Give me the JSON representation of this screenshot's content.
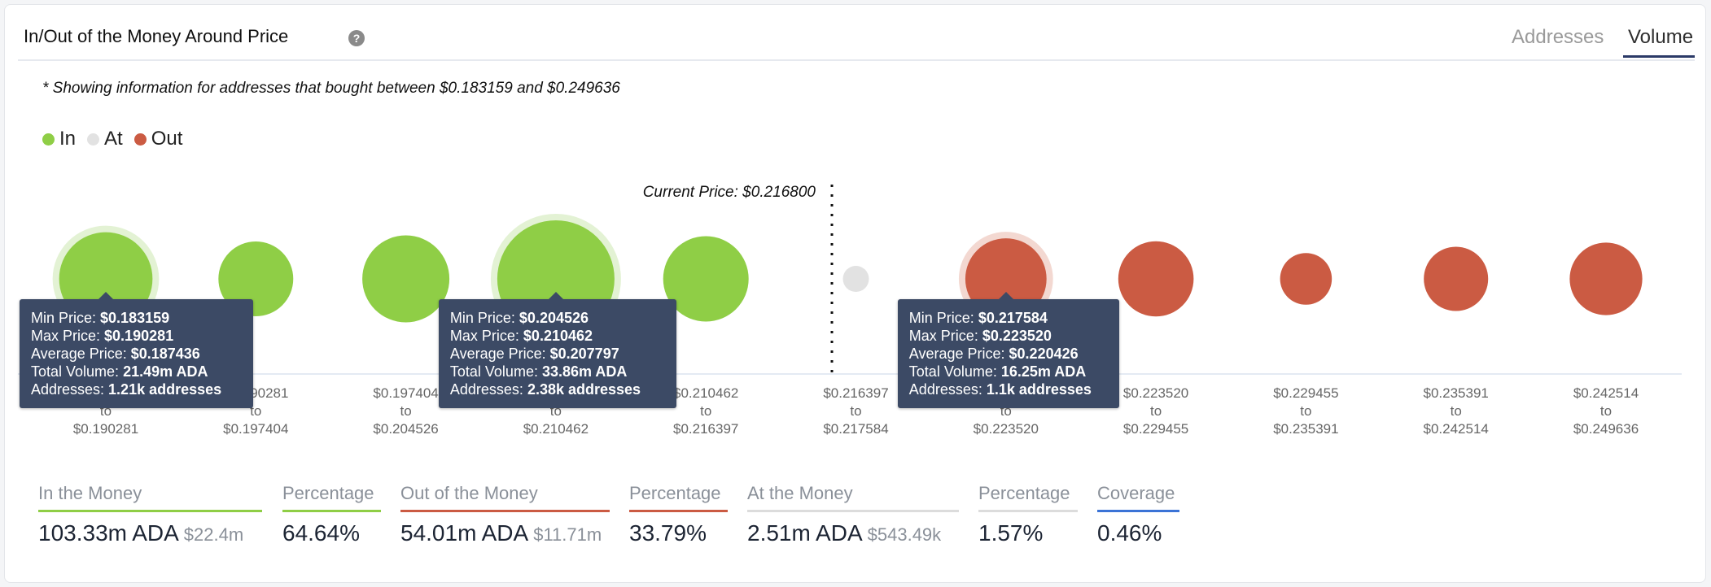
{
  "header": {
    "title": "In/Out of the Money Around Price",
    "help_icon": "question-circle-icon",
    "tabs": [
      {
        "label": "Addresses",
        "active": false
      },
      {
        "label": "Volume",
        "active": true
      }
    ]
  },
  "note": "* Showing information for addresses that bought between $0.183159 and $0.249636",
  "legend": [
    {
      "label": "In",
      "color": "#8fce46"
    },
    {
      "label": "At",
      "color": "#e2e2e2"
    },
    {
      "label": "Out",
      "color": "#cb5b43"
    }
  ],
  "colors": {
    "in": "#8fce46",
    "in_halo": "#e3f2d4",
    "at": "#e2e2e2",
    "out": "#cb5b43",
    "out_halo": "#f3d8d1",
    "tooltip_bg": "#3c4a65",
    "tab_active": "#2b3a67",
    "coverage": "#3b73d6"
  },
  "chart_data": {
    "type": "bubble",
    "title": "In/Out of the Money Around Price",
    "metric": "Total Volume (ADA)",
    "current_price_label": "Current Price: $0.216800",
    "current_price": 0.2168,
    "current_price_after_index": 4,
    "categories": [
      {
        "from": "$0.183159",
        "to": "$0.190281",
        "status": "in",
        "volume_m": 21.49,
        "highlighted": true
      },
      {
        "from": "$0.190281",
        "to": "$0.197404",
        "status": "in",
        "volume_m": 13.8
      },
      {
        "from": "$0.197404",
        "to": "$0.204526",
        "status": "in",
        "volume_m": 18.7
      },
      {
        "from": "$0.204526",
        "to": "$0.210462",
        "status": "in",
        "volume_m": 33.86,
        "highlighted": true
      },
      {
        "from": "$0.210462",
        "to": "$0.216397",
        "status": "in",
        "volume_m": 18.0
      },
      {
        "from": "$0.216397",
        "to": "$0.217584",
        "status": "at",
        "volume_m": 2.51
      },
      {
        "from": "$0.217584",
        "to": "$0.223520",
        "status": "out",
        "volume_m": 16.25,
        "highlighted": true
      },
      {
        "from": "$0.223520",
        "to": "$0.229455",
        "status": "out",
        "volume_m": 14.0
      },
      {
        "from": "$0.229455",
        "to": "$0.235391",
        "status": "out",
        "volume_m": 6.6
      },
      {
        "from": "$0.235391",
        "to": "$0.242514",
        "status": "out",
        "volume_m": 10.2
      },
      {
        "from": "$0.242514",
        "to": "$0.249636",
        "status": "out",
        "volume_m": 13.0
      }
    ],
    "x_label_connector": "to",
    "legend_position": "top-left"
  },
  "tooltips": [
    {
      "index": 0,
      "rows": [
        {
          "label": "Min Price: ",
          "value": "$0.183159"
        },
        {
          "label": "Max Price: ",
          "value": "$0.190281"
        },
        {
          "label": "Average Price: ",
          "value": "$0.187436"
        },
        {
          "label": "Total Volume: ",
          "value": "21.49m ADA"
        },
        {
          "label": "Addresses: ",
          "value": "1.21k addresses"
        }
      ]
    },
    {
      "index": 3,
      "rows": [
        {
          "label": "Min Price: ",
          "value": "$0.204526"
        },
        {
          "label": "Max Price: ",
          "value": "$0.210462"
        },
        {
          "label": "Average Price: ",
          "value": "$0.207797"
        },
        {
          "label": "Total Volume: ",
          "value": "33.86m ADA"
        },
        {
          "label": "Addresses: ",
          "value": "2.38k addresses"
        }
      ]
    },
    {
      "index": 6,
      "rows": [
        {
          "label": "Min Price: ",
          "value": "$0.217584"
        },
        {
          "label": "Max Price: ",
          "value": "$0.223520"
        },
        {
          "label": "Average Price: ",
          "value": "$0.220426"
        },
        {
          "label": "Total Volume: ",
          "value": "16.25m ADA"
        },
        {
          "label": "Addresses: ",
          "value": "1.1k addresses"
        }
      ]
    }
  ],
  "stats": [
    {
      "label": "In the Money",
      "value": "103.33m ADA",
      "sub": "$22.4m",
      "color": "#8fce46"
    },
    {
      "label": "Percentage",
      "value": "64.64%",
      "sub": "",
      "color": "#8fce46"
    },
    {
      "label": "Out of the Money",
      "value": "54.01m ADA",
      "sub": "$11.71m",
      "color": "#cb5b43"
    },
    {
      "label": "Percentage",
      "value": "33.79%",
      "sub": "",
      "color": "#cb5b43"
    },
    {
      "label": "At the Money",
      "value": "2.51m ADA",
      "sub": "$543.49k",
      "color": "#dcdcdc"
    },
    {
      "label": "Percentage",
      "value": "1.57%",
      "sub": "",
      "color": "#dcdcdc"
    },
    {
      "label": "Coverage",
      "value": "0.46%",
      "sub": "",
      "color": "#3b73d6"
    }
  ]
}
